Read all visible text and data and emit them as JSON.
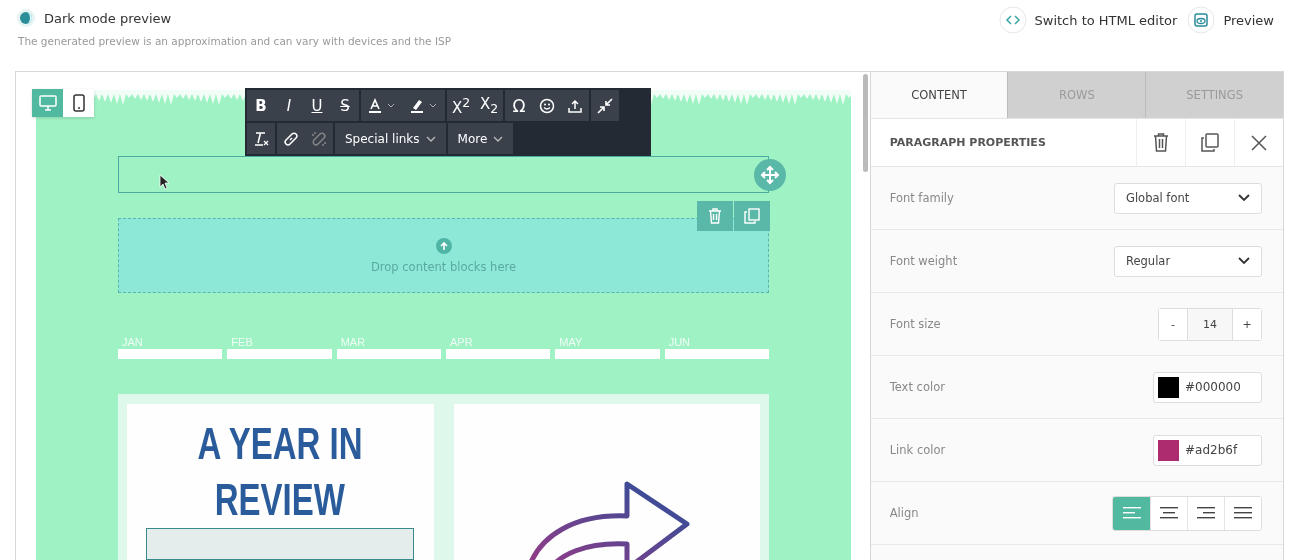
{
  "header": {
    "title": "Dark mode preview",
    "subtitle": "The generated preview is an approximation and can vary with devices and the ISP",
    "actions": [
      "Switch to HTML editor",
      "Preview"
    ]
  },
  "devices": [
    {
      "selected": true
    },
    {
      "selected": false
    }
  ],
  "toolbar": {
    "format": [
      "B",
      "I",
      "U",
      "S"
    ],
    "scripts": [
      "X$^{2}$",
      "X$_{2}$"
    ],
    "symbol": "Ω",
    "dropdowns": [
      "Special links",
      "More"
    ]
  },
  "canvas": {
    "drop_hint": "Drop content blocks here",
    "months": [
      "JAN",
      "FEB",
      "MAR",
      "APR",
      "MAY",
      "JUN"
    ],
    "headline": [
      "A YEAR IN",
      "REVIEW"
    ]
  },
  "panel": {
    "tabs": [
      {
        "label": "CONTENT",
        "selected": true
      },
      {
        "label": "ROWS",
        "selected": false
      },
      {
        "label": "SETTINGS",
        "selected": false
      }
    ],
    "section": "PARAGRAPH PROPERTIES",
    "properties": [
      {
        "kind": "select",
        "label": "Font family",
        "value": "Global font"
      },
      {
        "kind": "select",
        "label": "Font weight",
        "value": "Regular"
      },
      {
        "kind": "stepper",
        "label": "Font size",
        "minus": "-",
        "value": "14",
        "plus": "+"
      },
      {
        "kind": "color",
        "label": "Text color",
        "value": "#000000",
        "color": "#000000"
      },
      {
        "kind": "color",
        "label": "Link color",
        "value": "#ad2b6f",
        "color": "#ad2b6f"
      },
      {
        "kind": "align",
        "label": "Align",
        "options": [
          {
            "selected": true
          },
          {
            "selected": false
          },
          {
            "selected": false
          },
          {
            "selected": false
          }
        ]
      }
    ]
  }
}
